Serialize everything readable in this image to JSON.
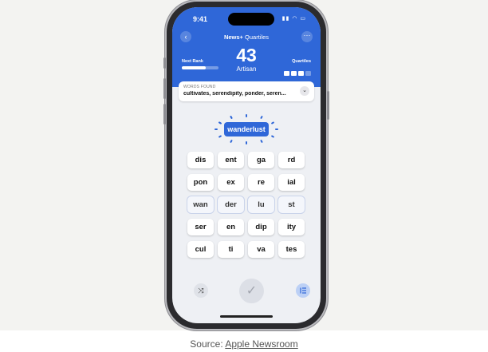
{
  "status": {
    "time": "9:41",
    "icons": "▮▮ ◠ ▭"
  },
  "header": {
    "back_icon": "‹",
    "more_icon": "···",
    "app_brand": "News+",
    "app_name": " Quartiles",
    "score": "43",
    "rank": "Artisan",
    "next_rank_label": "Next Rank",
    "next_rank_progress": 0.65,
    "quartiles_label": "Quartiles",
    "quartiles_found": 3,
    "quartiles_total": 4
  },
  "found": {
    "label": "WORDS FOUND",
    "words": "cultivates, serendipity, ponder, seren...",
    "chevron_icon": "⌄"
  },
  "current_word": "wanderlust",
  "tiles": [
    [
      "dis",
      "ent",
      "ga",
      "rd"
    ],
    [
      "pon",
      "ex",
      "re",
      "ial"
    ],
    [
      "wan",
      "der",
      "lu",
      "st"
    ],
    [
      "ser",
      "en",
      "dip",
      "ity"
    ],
    [
      "cul",
      "ti",
      "va",
      "tes"
    ]
  ],
  "controls": {
    "shuffle_icon": "⤨",
    "submit_icon": "✓",
    "list_icon": "list-icon"
  },
  "caption": {
    "prefix": "Source: ",
    "link": "Apple Newsroom"
  },
  "colors": {
    "accent": "#2f67d8",
    "background": "#eef0f4"
  }
}
